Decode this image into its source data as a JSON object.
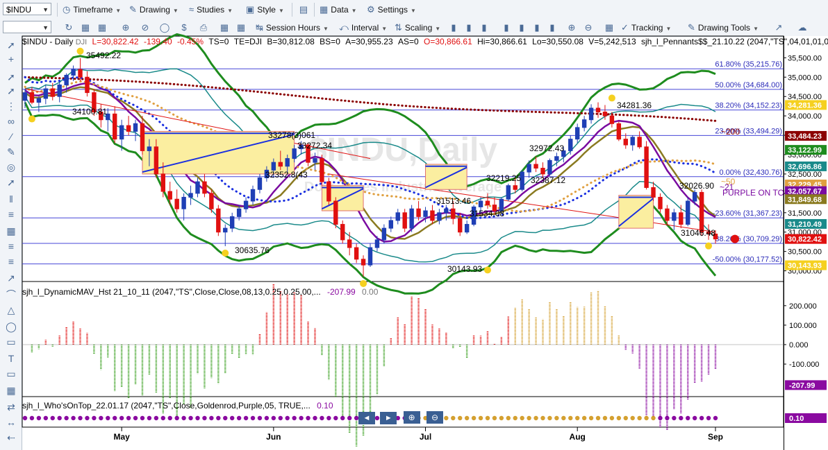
{
  "toolbar": {
    "symbol": "$INDU",
    "timeframe": "Timeframe",
    "drawing": "Drawing",
    "studies": "Studies",
    "style": "Style",
    "data": "Data",
    "settings": "Settings",
    "session_hours": "Session Hours",
    "interval": "Interval",
    "scaling": "Scaling",
    "tracking": "Tracking",
    "drawing_tools": "Drawing Tools"
  },
  "header": {
    "symbol_title": "$INDU - Daily",
    "exchange": "DJI",
    "last": "L=30,822.42",
    "change": "-139.40",
    "pct": "-0.45%",
    "ts": "TS=0",
    "te": "TE=DJI",
    "b": "B=30,812.08",
    "bs": "BS=0",
    "a": "A=30,955.23",
    "as": "AS=0",
    "o": "O=30,866.61",
    "hi": "Hi=30,866.61",
    "lo": "Lo=30,550.08",
    "v": "V=5,242,513",
    "study": "sjh_l_Pennants$$_21.10.22 (2047,\"TS\",04,01,01,01,01,01,..."
  },
  "watermark": {
    "title": "$INDU,Daily",
    "subtitle": "Dow Jones Industrial Average"
  },
  "colors": {
    "up_candle": "#1f3fb5",
    "down_candle": "#e01010",
    "fib_line": "#4646d8",
    "green_band": "#1e8c1e",
    "teal_band": "#1a8a8a",
    "purple_line": "#7a0aa0",
    "olive_line": "#8a7a20",
    "maroon_dots": "#8b0000",
    "blue_dots": "#1a2fe0",
    "orange_dots": "#e0a040",
    "osc_red": "#e01010",
    "osc_green": "#3aa020",
    "osc_purple": "#8a0aa0",
    "osc_gold": "#d4a030"
  },
  "chart_data": [
    {
      "type": "candlestick",
      "title": "$INDU - Daily",
      "y_ticks": [
        30000,
        30500,
        31000,
        31500,
        32000,
        32500,
        33000,
        33500,
        34000,
        34500,
        35000,
        35500
      ],
      "y_tick_labels": [
        "30,000.00",
        "30,500.00",
        "31,000.00",
        "31,500.00",
        "32,000.00",
        "32,500.00",
        "33,000.00",
        "33,500.00",
        "34,000.00",
        "34,500.00",
        "35,000.00",
        "35,500.00"
      ],
      "ylim": [
        29760,
        35810
      ],
      "x_labels": [
        {
          "label": "May",
          "x": "May"
        },
        {
          "label": "Jun",
          "x": "Jun"
        },
        {
          "label": "Jul",
          "x": "Jul"
        },
        {
          "label": "Aug",
          "x": "Aug"
        },
        {
          "label": "Sep",
          "x": "Sep"
        }
      ],
      "candles": [
        [
          34400,
          34700,
          34200,
          34600
        ],
        [
          34600,
          34750,
          34300,
          34350
        ],
        [
          34350,
          34500,
          34100,
          34450
        ],
        [
          34450,
          34800,
          34300,
          34700
        ],
        [
          34700,
          34850,
          34400,
          34500
        ],
        [
          34500,
          34900,
          34350,
          34800
        ],
        [
          34800,
          35100,
          34600,
          35050
        ],
        [
          35050,
          35300,
          34900,
          35200
        ],
        [
          35200,
          35492,
          34900,
          35000
        ],
        [
          35000,
          35150,
          34500,
          34600
        ],
        [
          34600,
          34700,
          34000,
          34100
        ],
        [
          34100,
          34300,
          33700,
          33900
        ],
        [
          33900,
          34200,
          33600,
          34050
        ],
        [
          34050,
          34250,
          33300,
          33400
        ],
        [
          33400,
          33900,
          33100,
          33750
        ],
        [
          33750,
          34000,
          33500,
          33600
        ],
        [
          33600,
          33900,
          33350,
          33800
        ],
        [
          33800,
          34000,
          33000,
          33100
        ],
        [
          33100,
          33400,
          32700,
          33200
        ],
        [
          33200,
          33400,
          32400,
          32500
        ],
        [
          32500,
          32800,
          31900,
          32050
        ],
        [
          32050,
          32300,
          31700,
          31850
        ],
        [
          31850,
          32100,
          31500,
          31600
        ],
        [
          31600,
          32000,
          31300,
          31900
        ],
        [
          31900,
          32200,
          31700,
          32000
        ],
        [
          32000,
          32400,
          31900,
          32300
        ],
        [
          32300,
          32500,
          31900,
          32000
        ],
        [
          32000,
          32100,
          31500,
          31600
        ],
        [
          31600,
          31700,
          30900,
          31000
        ],
        [
          31000,
          31200,
          30636,
          31100
        ],
        [
          31100,
          31500,
          31000,
          31400
        ],
        [
          31400,
          31700,
          31300,
          31600
        ],
        [
          31600,
          31900,
          31500,
          31800
        ],
        [
          31800,
          32200,
          31700,
          32100
        ],
        [
          32100,
          32500,
          32000,
          32400
        ],
        [
          32400,
          32700,
          32300,
          32600
        ],
        [
          32600,
          32900,
          32400,
          32800
        ],
        [
          32800,
          33100,
          32600,
          32700
        ],
        [
          32700,
          33000,
          32500,
          32900
        ],
        [
          32900,
          33250,
          32800,
          33150
        ],
        [
          33150,
          33350,
          33000,
          33250
        ],
        [
          33250,
          33300,
          32700,
          32800
        ],
        [
          32800,
          33050,
          32600,
          32900
        ],
        [
          32900,
          33000,
          32200,
          32300
        ],
        [
          32300,
          32400,
          31700,
          31800
        ],
        [
          31800,
          31900,
          31100,
          31200
        ],
        [
          31200,
          31300,
          30700,
          30800
        ],
        [
          30800,
          31000,
          30400,
          30600
        ],
        [
          30600,
          30700,
          30200,
          30300
        ],
        [
          30300,
          30400,
          29850,
          30150
        ],
        [
          30150,
          30700,
          30100,
          30600
        ],
        [
          30600,
          30900,
          30500,
          30800
        ],
        [
          30800,
          31200,
          30700,
          31100
        ],
        [
          31100,
          31400,
          31000,
          31300
        ],
        [
          31300,
          31600,
          31200,
          31500
        ],
        [
          31500,
          31600,
          31000,
          31100
        ],
        [
          31100,
          31700,
          31000,
          31600
        ],
        [
          31600,
          31800,
          31300,
          31400
        ],
        [
          31400,
          31650,
          31250,
          31550
        ],
        [
          31550,
          31700,
          31200,
          31300
        ],
        [
          31300,
          31600,
          31200,
          31500
        ],
        [
          31500,
          31700,
          31300,
          31600
        ],
        [
          31600,
          31800,
          31200,
          31350
        ],
        [
          31350,
          31500,
          30900,
          31000
        ],
        [
          31000,
          31300,
          30950,
          31200
        ],
        [
          31200,
          31700,
          31150,
          31650
        ],
        [
          31650,
          31900,
          31500,
          31800
        ],
        [
          31800,
          32000,
          31600,
          31700
        ],
        [
          31700,
          31900,
          31450,
          31550
        ],
        [
          31550,
          31900,
          31500,
          31850
        ],
        [
          31850,
          32250,
          31800,
          32200
        ],
        [
          32200,
          32400,
          32000,
          32100
        ],
        [
          32100,
          32600,
          32050,
          32550
        ],
        [
          32550,
          32850,
          32400,
          32750
        ],
        [
          32750,
          32950,
          32550,
          32650
        ],
        [
          32650,
          32800,
          32387,
          32500
        ],
        [
          32500,
          32900,
          32450,
          32850
        ],
        [
          32850,
          33050,
          32700,
          32950
        ],
        [
          32950,
          33200,
          32800,
          33100
        ],
        [
          33100,
          33500,
          33000,
          33400
        ],
        [
          33400,
          33800,
          33300,
          33700
        ],
        [
          33700,
          34000,
          33600,
          33900
        ],
        [
          33900,
          34300,
          33800,
          34200
        ],
        [
          34200,
          34350,
          33950,
          34100
        ],
        [
          34100,
          34281,
          33900,
          34000
        ],
        [
          34000,
          34100,
          33700,
          33800
        ],
        [
          33800,
          33850,
          33350,
          33400
        ],
        [
          33400,
          33550,
          33150,
          33250
        ],
        [
          33250,
          33500,
          33100,
          33450
        ],
        [
          33450,
          33600,
          33150,
          33200
        ],
        [
          33200,
          33350,
          32100,
          32150
        ],
        [
          32150,
          32300,
          31800,
          31900
        ],
        [
          31900,
          32000,
          31500,
          31600
        ],
        [
          31600,
          31700,
          31200,
          31300
        ],
        [
          31300,
          31600,
          31050,
          31500
        ],
        [
          31500,
          31700,
          31100,
          31200
        ],
        [
          31200,
          31900,
          31150,
          31800
        ],
        [
          31800,
          32100,
          31700,
          32026
        ],
        [
          32026,
          32100,
          30900,
          31000
        ],
        [
          31000,
          31200,
          30800,
          30950
        ],
        [
          30950,
          31050,
          30700,
          30822
        ]
      ]
    },
    {
      "type": "bar",
      "title": "sjh_l_DynamicMAV_Hst 21_10_11 (2047,\"TS\",Close,Close,08,13,0.25,0.25,00,...",
      "values_text": [
        "-207.99",
        "0.00"
      ],
      "y_tick_labels": [
        "200.000",
        "100.000",
        "0.000",
        "-100.000"
      ],
      "last_value": "-207.99"
    },
    {
      "type": "other",
      "title": "sjh_l_Who'sOnTop_22.01.17 (2047,\"TS\",Close,Goldenrod,Purple,05, TRUE,...",
      "value_text": "0.10",
      "last_value": "0.10"
    }
  ],
  "fib_levels": [
    {
      "label": "61.80% (35,215.76)",
      "value": 35215.76
    },
    {
      "label": "50.00% (34,684.00)",
      "value": 34684.0
    },
    {
      "label": "38.20% (34,152.23)",
      "value": 34152.23
    },
    {
      "label": "23.60% (33,494.29)",
      "value": 33494.29
    },
    {
      "label": "0.00% (32,430.76)",
      "value": 32430.76
    },
    {
      "label": "-23.60% (31,367.23)",
      "value": 31367.23
    },
    {
      "label": "38.20% (30,709.29)",
      "value": 30709.29
    },
    {
      "label": "-50.00% (30,177.52)",
      "value": 30177.52
    }
  ],
  "price_annotations": [
    {
      "text": "35492.22"
    },
    {
      "text": "34100.81"
    },
    {
      "text": "30635.76"
    },
    {
      "text": "33272.34"
    },
    {
      "text": "32352.8(43"
    },
    {
      "text": "33278(3)061"
    },
    {
      "text": "31513.46"
    },
    {
      "text": "31534.08"
    },
    {
      "text": "32219.25"
    },
    {
      "text": "32387.12"
    },
    {
      "text": "32972.43"
    },
    {
      "text": "34281.36"
    },
    {
      "text": "30143.93"
    },
    {
      "text": "32026.90"
    },
    {
      "text": "31046.48"
    },
    {
      "text": "~200"
    },
    {
      "text": "~50"
    },
    {
      "text": "~21"
    },
    {
      "text": "PURPLE ON TOP"
    }
  ],
  "right_badges": [
    {
      "text": "34,281.36",
      "color": "#f5d020",
      "fg": "#ffffff"
    },
    {
      "text": "33,484.23",
      "color": "#8b0000",
      "fg": "#ffffff"
    },
    {
      "text": "33,122.99",
      "color": "#1e8c1e",
      "fg": "#ffffff"
    },
    {
      "text": "32,696.86",
      "color": "#1a8a8a",
      "fg": "#ffffff"
    },
    {
      "text": "32,229.45",
      "color": "#e0a040",
      "fg": "#ffffff"
    },
    {
      "text": "32,057.67",
      "color": "#7a0aa0",
      "fg": "#ffffff"
    },
    {
      "text": "31,849.68",
      "color": "#8a7a20",
      "fg": "#ffffff"
    },
    {
      "text": "31,210.49",
      "color": "#1a8a8a",
      "fg": "#ffffff"
    },
    {
      "text": "30,822.42",
      "color": "#e01010",
      "fg": "#ffffff"
    },
    {
      "text": "30,143.93",
      "color": "#f5d020",
      "fg": "#ffffff"
    }
  ]
}
